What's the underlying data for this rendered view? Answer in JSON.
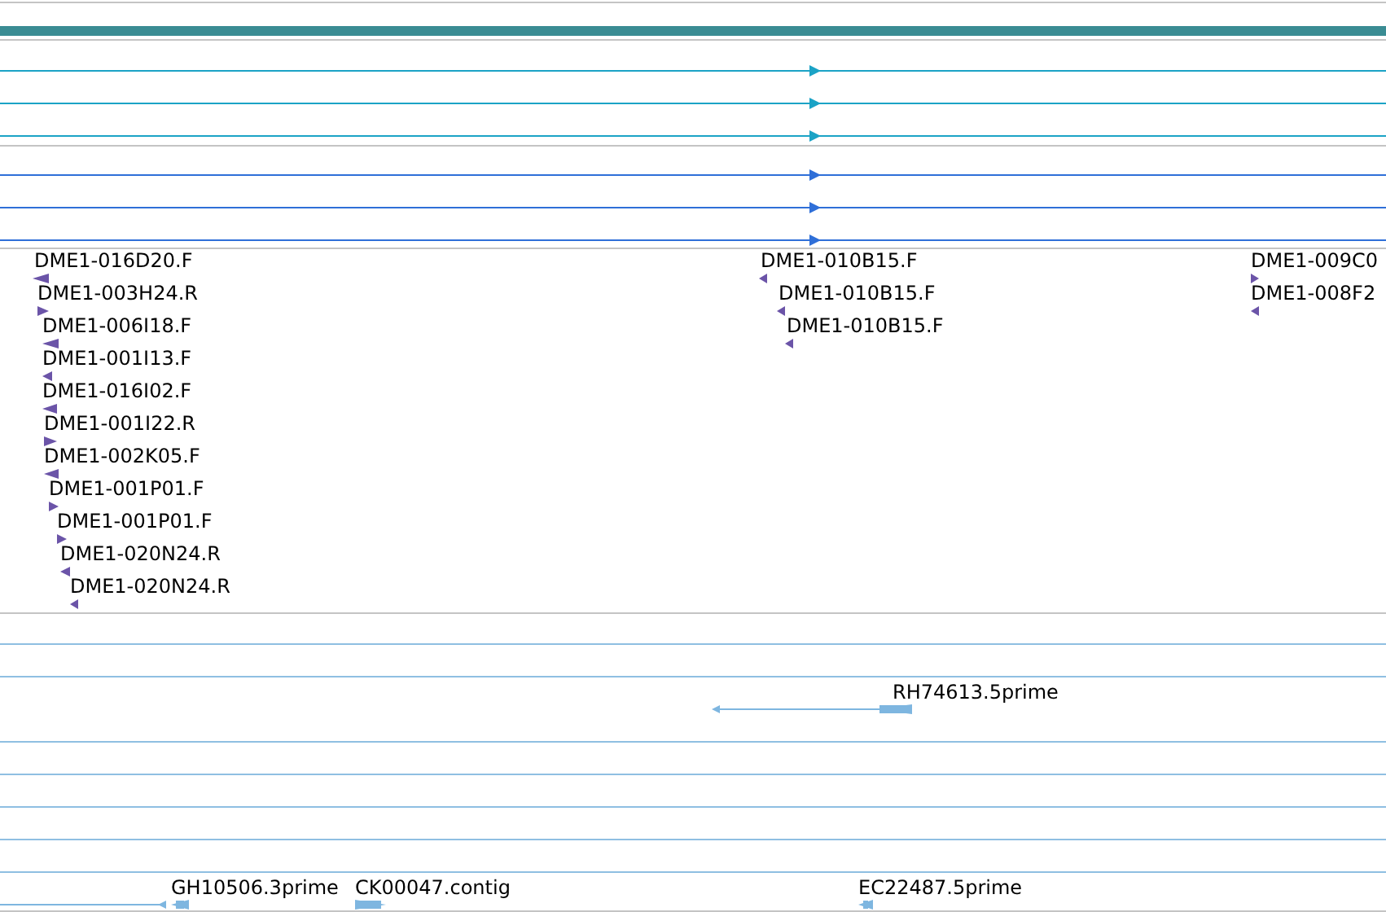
{
  "transcripts": [
    {
      "reverse": false,
      "color": "#1ba3c6"
    },
    {
      "reverse": false,
      "color": "#1ba3c6"
    },
    {
      "reverse": false,
      "color": "#1ba3c6"
    },
    {
      "reverse": false,
      "color": "#2f6fd8"
    },
    {
      "reverse": false,
      "color": "#2f6fd8"
    },
    {
      "reverse": false,
      "color": "#2f6fd8"
    }
  ],
  "clones": [
    {
      "label": "DME1-016D20.F",
      "reverse": true
    },
    {
      "label": "DME1-003H24.R",
      "reverse": false
    },
    {
      "label": "DME1-006I18.F",
      "reverse": true
    },
    {
      "label": "DME1-001I13.F",
      "reverse": true
    },
    {
      "label": "DME1-016I02.F",
      "reverse": true
    },
    {
      "label": "DME1-001I22.R",
      "reverse": false
    },
    {
      "label": "DME1-002K05.F",
      "reverse": true
    },
    {
      "label": "DME1-001P01.F",
      "reverse": false
    },
    {
      "label": "DME1-001P01.F",
      "reverse": false
    },
    {
      "label": "DME1-020N24.R",
      "reverse": true
    },
    {
      "label": "DME1-020N24.R",
      "reverse": true
    },
    {
      "label": "DME1-010B15.F",
      "reverse": true
    },
    {
      "label": "DME1-010B15.F",
      "reverse": true
    },
    {
      "label": "DME1-010B15.F",
      "reverse": true
    },
    {
      "label": "DME1-009C0",
      "reverse": false
    },
    {
      "label": "DME1-008F2",
      "reverse": true
    }
  ],
  "ests": [
    {
      "label": "RH74613.5prime",
      "reverse": true
    },
    {
      "label": "GH10506.3prime",
      "reverse": true
    },
    {
      "label": "CK00047.contig",
      "reverse": false
    },
    {
      "label": "EC22487.5prime",
      "reverse": true
    }
  ]
}
